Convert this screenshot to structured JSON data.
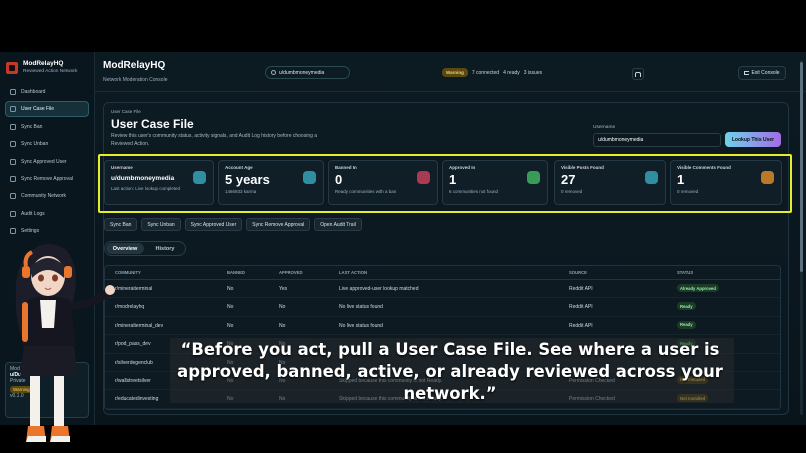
{
  "app": {
    "brand_title": "ModRelayHQ",
    "brand_subtitle": "Reviewed Action Network",
    "page_title": "ModRelayHQ",
    "page_subtitle": "Network Moderation Console"
  },
  "colors": {
    "accent": "#6fd3e9",
    "accent_2": "#a26ce6",
    "highlight": "#e6ee2a",
    "warning": "#f0d36a",
    "success": "#9ae6ad"
  },
  "sidebar": {
    "items": [
      {
        "label": "Dashboard",
        "icon": "grid-icon",
        "active": false
      },
      {
        "label": "User Case File",
        "icon": "search-icon",
        "active": true
      },
      {
        "label": "Sync Ban",
        "icon": "ban-icon",
        "active": false
      },
      {
        "label": "Sync Unban",
        "icon": "unban-icon",
        "active": false
      },
      {
        "label": "Sync Approved User",
        "icon": "user-check-icon",
        "active": false
      },
      {
        "label": "Sync Remove Approval",
        "icon": "user-remove-icon",
        "active": false
      },
      {
        "label": "Community Network",
        "icon": "network-icon",
        "active": false
      },
      {
        "label": "Audit Logs",
        "icon": "log-icon",
        "active": false
      },
      {
        "label": "Settings",
        "icon": "gear-icon",
        "active": false
      }
    ],
    "card": {
      "line1": "Mod Acc",
      "line2": "u/Dumb",
      "line3": "Private",
      "badge": "Warning",
      "version": "v0.1.0"
    }
  },
  "header": {
    "search_value": "u/dumbmoneymedia",
    "warning_label": "Warning",
    "connected_text": "7 connected",
    "ready_text": "4 ready",
    "issues_text": "3 issues",
    "exit_label": "Exit Console"
  },
  "case_file": {
    "eyebrow": "User Case File",
    "title": "User Case File",
    "description": "Review this user's community status, activity signals, and Audit Log history before choosing a Reviewed Action.",
    "username_label": "Username",
    "username_value": "u/dumbmoneymedia",
    "lookup_label": "Lookup This User"
  },
  "stats": [
    {
      "label": "Username",
      "value": "u/dumbmoneymedia",
      "sub": "Last action: Live lookup completed",
      "icon_color": "#2f8fa0"
    },
    {
      "label": "Account Age",
      "value": "5 years",
      "sub": "1466933 karma",
      "icon_color": "#2f8fa0"
    },
    {
      "label": "Banned In",
      "value": "0",
      "sub": "Ready communities with a ban",
      "icon_color": "#a83a52"
    },
    {
      "label": "Approved In",
      "value": "1",
      "sub": "6 communities not found",
      "icon_color": "#3a9a5a"
    },
    {
      "label": "Visible Posts Found",
      "value": "27",
      "sub": "0 removed",
      "icon_color": "#2f8fa0"
    },
    {
      "label": "Visible Comments Found",
      "value": "1",
      "sub": "0 removed",
      "icon_color": "#b87a2a"
    }
  ],
  "actions": [
    "Sync Ban",
    "Sync Unban",
    "Sync Approved User",
    "Sync Remove Approval",
    "Open Audit Trail"
  ],
  "tabs": [
    {
      "label": "Overview",
      "active": true
    },
    {
      "label": "History",
      "active": false
    }
  ],
  "table": {
    "headers": [
      "COMMUNITY",
      "BANNED",
      "APPROVED",
      "LAST ACTION",
      "SOURCE",
      "STATUS"
    ],
    "rows": [
      {
        "community": "r/mineraiterminal",
        "banned": "No",
        "approved": "Yes",
        "last_action": "Live approved-user lookup matched",
        "source": "Reddit API",
        "status": "Already Approved",
        "tone": "green"
      },
      {
        "community": "r/modrelayhq",
        "banned": "No",
        "approved": "No",
        "last_action": "No live status found",
        "source": "Reddit API",
        "status": "Ready",
        "tone": "green"
      },
      {
        "community": "r/mineralterminal_dev",
        "banned": "No",
        "approved": "No",
        "last_action": "No live status found",
        "source": "Reddit API",
        "status": "Ready",
        "tone": "green"
      },
      {
        "community": "r/pod_pass_dev",
        "banned": "No",
        "approved": "No",
        "last_action": "",
        "source": "",
        "status": "Ready",
        "tone": "green"
      },
      {
        "community": "r/silverdegenclub",
        "banned": "No",
        "approved": "No",
        "last_action": "",
        "source": "",
        "status": "",
        "tone": "amber"
      },
      {
        "community": "r/wallstreetsilver",
        "banned": "No",
        "approved": "No",
        "last_action": "Skipped because this community is not Ready.",
        "source": "Permission Checked",
        "status": "Not Installed",
        "tone": "amber"
      },
      {
        "community": "r/educatedinvesting",
        "banned": "No",
        "approved": "No",
        "last_action": "Skipped because this community is not Ready.",
        "source": "Permission Checked",
        "status": "Not Installed",
        "tone": "amber"
      }
    ]
  },
  "caption": "“Before you act, pull a User Case File. See where a user is approved, banned, active, or already reviewed across your network.”"
}
